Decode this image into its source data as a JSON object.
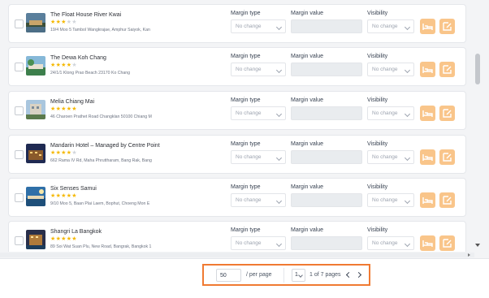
{
  "colors": {
    "accent": "#f9c58a",
    "pager_highlight": "#f07a32",
    "star": "#f5b800"
  },
  "field_labels": {
    "margin_type": "Margin type",
    "margin_value": "Margin value",
    "visibility": "Visibility"
  },
  "hotels": [
    {
      "name": "The Float House River Kwai",
      "stars": 3,
      "address": "19/4 Moo 5 Tambol Wangkrajae, Amphur Saiyok, Kan",
      "margin_type": "No change",
      "margin_value": "",
      "visibility": "No change"
    },
    {
      "name": "The Dewa Koh Chang",
      "stars": 4,
      "address": "24/1/1 Klong Prao Beach 23170 Ko Chang",
      "margin_type": "No change",
      "margin_value": "",
      "visibility": "No change"
    },
    {
      "name": "Melia Chiang Mai",
      "stars": 5,
      "address": "46 Charoen Prathet Road Changklan 50100 Chiang M",
      "margin_type": "No change",
      "margin_value": "",
      "visibility": "No change"
    },
    {
      "name": "Mandarin Hotel – Managed by Centre Point",
      "stars": 4,
      "address": "662 Rama IV Rd, Maha Phruttharam, Bang Rak, Bang",
      "margin_type": "No change",
      "margin_value": "",
      "visibility": "No change"
    },
    {
      "name": "Six Senses Samui",
      "stars": 5,
      "address": "9/10 Moo 5, Baan Plai Laem, Bophut, Choeng Mon E",
      "margin_type": "No change",
      "margin_value": "",
      "visibility": "No change"
    },
    {
      "name": "Shangri La Bangkok",
      "stars": 5,
      "address": "89 Soi Wat Suan Plu, New Road, Bangrak, Bangkok 1",
      "margin_type": "No change",
      "margin_value": "",
      "visibility": "No change"
    }
  ],
  "pagination": {
    "per_page_value": "50",
    "per_page_label": "/ per page",
    "page_value": "1",
    "page_info": "1 of 7 pages"
  },
  "icons": {
    "bed": "bed-icon",
    "edit": "edit-icon",
    "prev": "chevron-left-icon",
    "next": "chevron-right-icon"
  }
}
